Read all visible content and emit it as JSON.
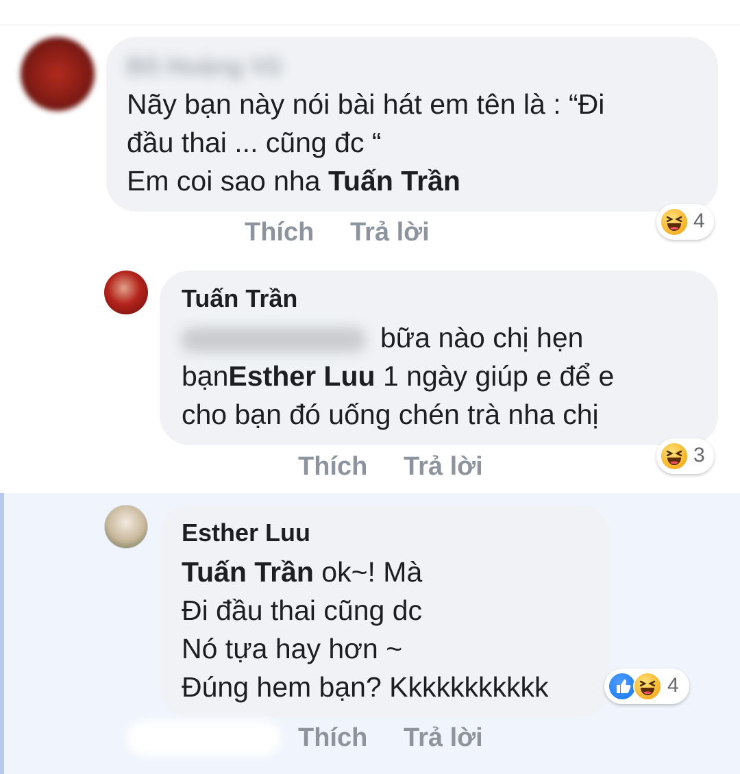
{
  "comments": [
    {
      "author": "Bồ Hoàng Vũ",
      "lines": [
        "Nãy bạn này nói bài hát em tên là : “Đi",
        "đầu thai ... cũng đc “"
      ],
      "line3_prefix": "Em coi sao nha ",
      "line3_mention": "Tuấn Trần",
      "reaction_count": "4",
      "actions": {
        "like": "Thích",
        "reply": "Trả lời"
      }
    },
    {
      "author": "Tuấn Trần",
      "line1_suffix": "bữa nào chị hẹn",
      "line2_prefix": "bạn",
      "line2_mention": "Esther Luu",
      "line2_suffix": " 1 ngày giúp e để e",
      "line3": "cho bạn đó uống chén trà nha chị",
      "reaction_count": "3",
      "actions": {
        "like": "Thích",
        "reply": "Trả lời"
      }
    },
    {
      "author": "Esther Luu",
      "line1_mention": "Tuấn Trần",
      "line1_suffix": " ok~! Mà",
      "lines": [
        "Đi đầu thai cũng dc",
        "Nó tựa hay hơn ~",
        "Đúng hem bạn? Kkkkkkkkkkk"
      ],
      "reaction_count": "4",
      "actions": {
        "like": "Thích",
        "reply": "Trả lời"
      }
    }
  ],
  "icons": {
    "reaction_haha": "haha-emoji-icon",
    "reaction_like": "like-thumb-icon"
  },
  "colors": {
    "bubble": "#f0f2f5",
    "action_text": "#8d949e",
    "like_blue": "#1877f2",
    "haha_yellow": "#f7b125",
    "highlight": "#f0f4fc"
  }
}
